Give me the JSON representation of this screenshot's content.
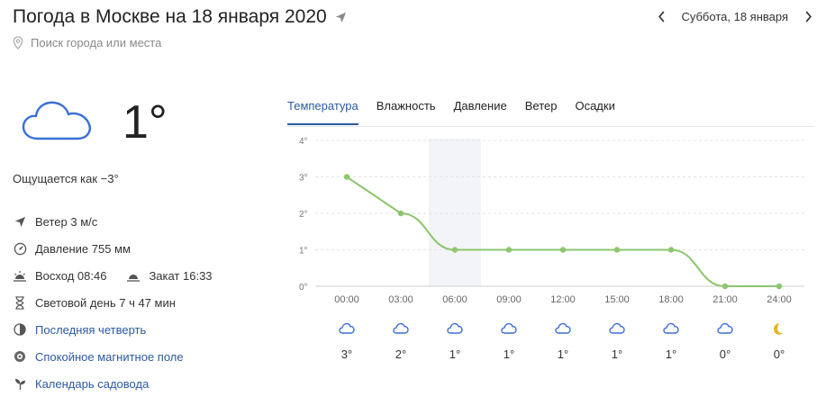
{
  "header": {
    "title": "Погода в Москве на 18 января 2020",
    "date_label": "Суббота, 18 января"
  },
  "search": {
    "placeholder": "Поиск города или места"
  },
  "current": {
    "temperature": "1°",
    "feels_like": "Ощущается как −3°",
    "icon": "cloud-icon"
  },
  "details": {
    "wind": "Ветер 3 м/с",
    "pressure": "Давление 755 мм",
    "sunrise": "Восход 08:46",
    "sunset": "Закат 16:33",
    "daylight": "Световой день 7 ч 47 мин",
    "moon_phase": "Последняя четверть",
    "magnetic": "Спокойное магнитное поле",
    "garden": "Календарь садовода"
  },
  "tabs": [
    {
      "label": "Температура",
      "active": true
    },
    {
      "label": "Влажность",
      "active": false
    },
    {
      "label": "Давление",
      "active": false
    },
    {
      "label": "Ветер",
      "active": false
    },
    {
      "label": "Осадки",
      "active": false
    }
  ],
  "colors": {
    "accent": "#2c5aa0",
    "line": "#8cc66d",
    "icon": "#3a6fd8",
    "moon": "#e6b422"
  },
  "chart_data": {
    "type": "line",
    "x": [
      "00:00",
      "03:00",
      "06:00",
      "09:00",
      "12:00",
      "15:00",
      "18:00",
      "21:00",
      "24:00"
    ],
    "series": [
      {
        "values": [
          3,
          2,
          1,
          1,
          1,
          1,
          1,
          0,
          0
        ]
      }
    ],
    "y_ticks": [
      "0°",
      "1°",
      "2°",
      "3°",
      "4°"
    ],
    "ylim": [
      0,
      4
    ],
    "grid": true,
    "highlight_category": "06:00"
  },
  "hourly": [
    {
      "icon": "cloud-icon",
      "temp": "3°"
    },
    {
      "icon": "cloud-icon",
      "temp": "2°"
    },
    {
      "icon": "cloud-icon",
      "temp": "1°"
    },
    {
      "icon": "cloud-icon",
      "temp": "1°"
    },
    {
      "icon": "cloud-icon",
      "temp": "1°"
    },
    {
      "icon": "cloud-icon",
      "temp": "1°"
    },
    {
      "icon": "cloud-icon",
      "temp": "1°"
    },
    {
      "icon": "cloud-icon",
      "temp": "0°"
    },
    {
      "icon": "moon-icon",
      "temp": "0°"
    }
  ]
}
